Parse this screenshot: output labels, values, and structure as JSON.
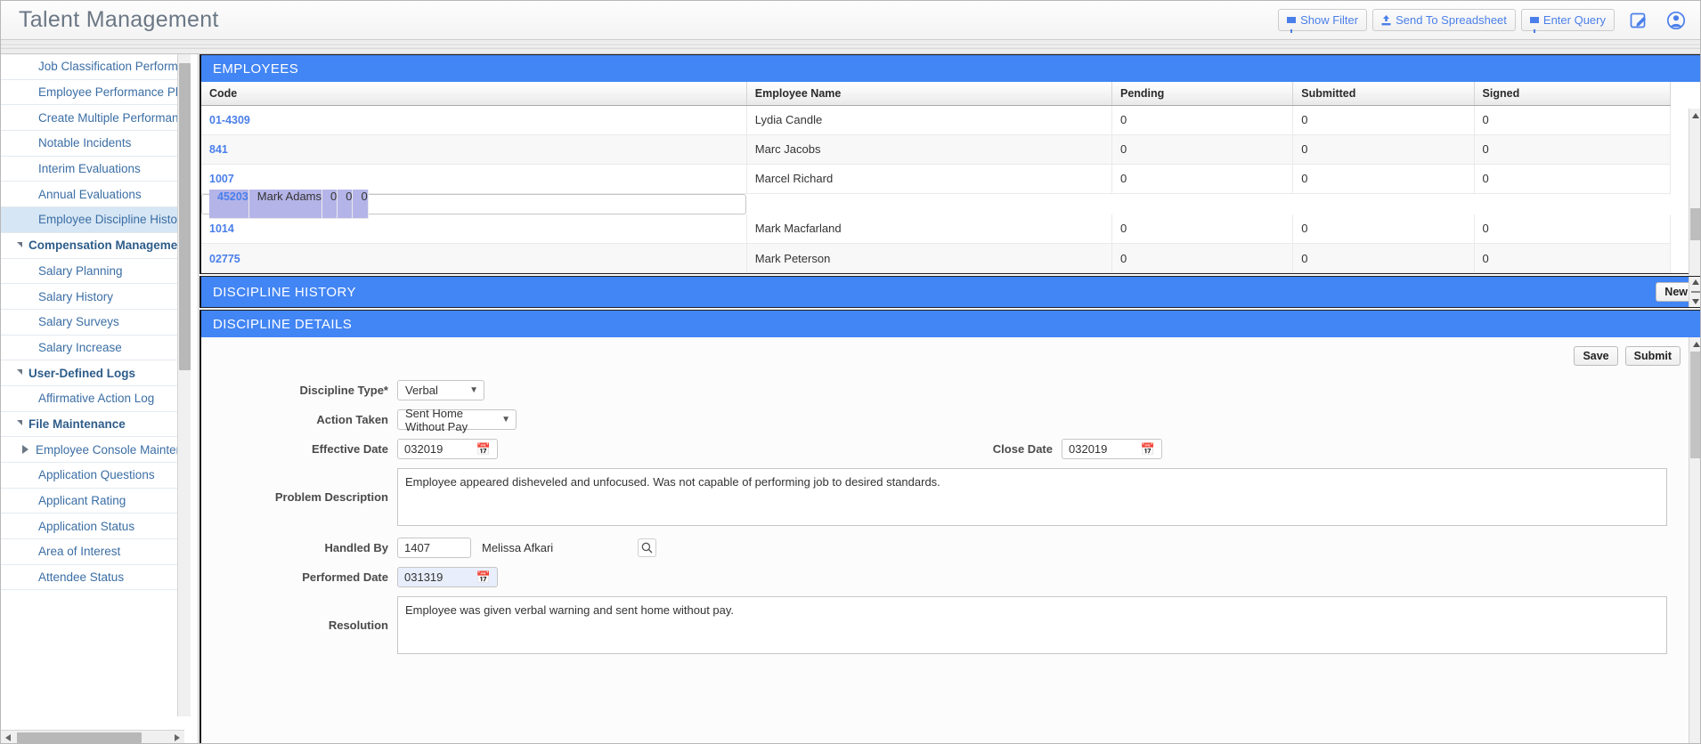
{
  "app": {
    "title": "Talent Management"
  },
  "topbar": {
    "buttons": [
      {
        "label": "Show Filter",
        "icon": "funnel-icon"
      },
      {
        "label": "Send To Spreadsheet",
        "icon": "upload-icon"
      },
      {
        "label": "Enter Query",
        "icon": "funnel-icon"
      }
    ],
    "icons": [
      {
        "name": "edit-note-icon",
        "glyph": "✎"
      },
      {
        "name": "user-account-icon",
        "glyph": "●"
      }
    ],
    "accent_color": "#4a7fea"
  },
  "sidebar": {
    "items": [
      {
        "label": "Job Classification Performance St",
        "type": "sub",
        "selected": false
      },
      {
        "label": "Employee Performance Plans",
        "type": "sub",
        "selected": false
      },
      {
        "label": "Create Multiple Performance Plan",
        "type": "sub",
        "selected": false
      },
      {
        "label": "Notable Incidents",
        "type": "sub",
        "selected": false
      },
      {
        "label": "Interim Evaluations",
        "type": "sub",
        "selected": false
      },
      {
        "label": "Annual Evaluations",
        "type": "sub",
        "selected": false
      },
      {
        "label": "Employee Discipline History",
        "type": "sub",
        "selected": true
      },
      {
        "label": "Compensation Management",
        "type": "group",
        "selected": false
      },
      {
        "label": "Salary Planning",
        "type": "sub",
        "selected": false
      },
      {
        "label": "Salary History",
        "type": "sub",
        "selected": false
      },
      {
        "label": "Salary Surveys",
        "type": "sub",
        "selected": false
      },
      {
        "label": "Salary Increase",
        "type": "sub",
        "selected": false
      },
      {
        "label": "User-Defined Logs",
        "type": "group",
        "selected": false
      },
      {
        "label": "Affirmative Action Log",
        "type": "sub",
        "selected": false
      },
      {
        "label": "File Maintenance",
        "type": "group",
        "selected": false
      },
      {
        "label": "Employee Console Maintenance",
        "type": "expander",
        "selected": false
      },
      {
        "label": "Application Questions",
        "type": "sub",
        "selected": false
      },
      {
        "label": "Applicant Rating",
        "type": "sub",
        "selected": false
      },
      {
        "label": "Application Status",
        "type": "sub",
        "selected": false
      },
      {
        "label": "Area of Interest",
        "type": "sub",
        "selected": false
      },
      {
        "label": "Attendee Status",
        "type": "sub",
        "selected": false
      }
    ]
  },
  "employees": {
    "title": "EMPLOYEES",
    "columns": [
      "Code",
      "Employee Name",
      "Pending",
      "Submitted",
      "Signed"
    ],
    "rows": [
      {
        "code": "01-4309",
        "name": "Lydia Candle",
        "pending": "0",
        "submitted": "0",
        "signed": "0",
        "selected": false
      },
      {
        "code": "841",
        "name": "Marc Jacobs",
        "pending": "0",
        "submitted": "0",
        "signed": "0",
        "selected": false
      },
      {
        "code": "1007",
        "name": "Marcel Richard",
        "pending": "0",
        "submitted": "0",
        "signed": "0",
        "selected": false
      },
      {
        "code": "45203",
        "name": "Mark Adams",
        "pending": "0",
        "submitted": "0",
        "signed": "0",
        "selected": true
      },
      {
        "code": "1014",
        "name": "Mark Macfarland",
        "pending": "0",
        "submitted": "0",
        "signed": "0",
        "selected": false
      },
      {
        "code": "02775",
        "name": "Mark Peterson",
        "pending": "0",
        "submitted": "0",
        "signed": "0",
        "selected": false
      }
    ]
  },
  "discipline_history": {
    "title": "DISCIPLINE HISTORY",
    "new_label": "New"
  },
  "discipline_details": {
    "title": "DISCIPLINE DETAILS",
    "save_label": "Save",
    "submit_label": "Submit",
    "fields": {
      "discipline_type": {
        "label": "Discipline Type*",
        "value": "Verbal"
      },
      "action_taken": {
        "label": "Action Taken",
        "value": "Sent Home Without Pay"
      },
      "effective_date": {
        "label": "Effective Date",
        "value": "032019"
      },
      "close_date": {
        "label": "Close Date",
        "value": "032019"
      },
      "problem_description": {
        "label": "Problem Description",
        "value": "Employee appeared disheveled and unfocused. Was not capable of performing job to desired standards."
      },
      "handled_by": {
        "label": "Handled By",
        "code": "1407",
        "name": "Melissa Afkari"
      },
      "performed_date": {
        "label": "Performed Date",
        "value": "031319"
      },
      "resolution": {
        "label": "Resolution",
        "value": "Employee was given verbal warning and sent home without pay."
      }
    }
  },
  "colors": {
    "header_blue": "#4285f4",
    "selected_row": "#b5b4e8",
    "link_blue": "#4a7fea",
    "sidebar_selected": "#d6e6f4"
  }
}
